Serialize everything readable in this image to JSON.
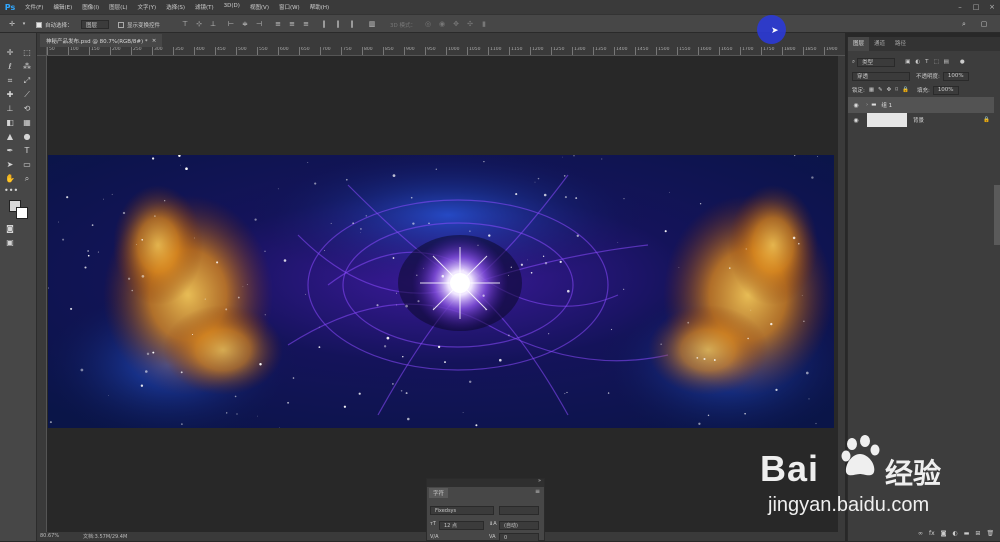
{
  "app": {
    "logo": "Ps"
  },
  "menu": [
    "文件(F)",
    "编辑(E)",
    "图像(I)",
    "图层(L)",
    "文字(Y)",
    "选择(S)",
    "滤镜(T)",
    "3D(D)",
    "视图(V)",
    "窗口(W)",
    "帮助(H)"
  ],
  "options": {
    "auto_select_label": "自动选择：",
    "auto_select_value": "图层",
    "show_transform_label": "显示变换控件",
    "mode_3d_label": "3D 模式："
  },
  "document": {
    "tab_title": "神秘产品发布.psd @ 80.7%(RGB/8#) *",
    "close": "×"
  },
  "ruler_ticks": [
    "50",
    "100",
    "150",
    "200",
    "250",
    "300",
    "350",
    "400",
    "450",
    "500",
    "550",
    "600",
    "650",
    "700",
    "750",
    "800",
    "850",
    "900",
    "950",
    "1000",
    "1050",
    "1100",
    "1150",
    "1200",
    "1250",
    "1300",
    "1350",
    "1400",
    "1450",
    "1500",
    "1550",
    "1600",
    "1650",
    "1700",
    "1750",
    "1800",
    "1850",
    "1900"
  ],
  "status": {
    "zoom": "80.67%",
    "doc_info": "文档:3.57M/29.4M"
  },
  "layers_panel": {
    "tabs": [
      "图层",
      "通道",
      "路径"
    ],
    "filter_kind": "类型",
    "blend_mode": "穿透",
    "opacity_label": "不透明度:",
    "opacity_value": "100%",
    "lock_label": "锁定:",
    "fill_label": "填充:",
    "fill_value": "100%",
    "layers": [
      {
        "name": "组 1",
        "type": "group"
      },
      {
        "name": "背景",
        "type": "background"
      }
    ]
  },
  "character_panel": {
    "tab": "字符",
    "font": "Fixedsys",
    "size": "12 点",
    "leading": "(自动)",
    "kerning_label": "V/A",
    "tracking_label": "VA",
    "tracking_value": "0"
  },
  "watermark": {
    "brand": "Bai",
    "suffix": "经验",
    "url": "jingyan.baidu.com"
  },
  "colors": {
    "accent": "#31a8ff",
    "cursor": "#2b3ad6"
  }
}
